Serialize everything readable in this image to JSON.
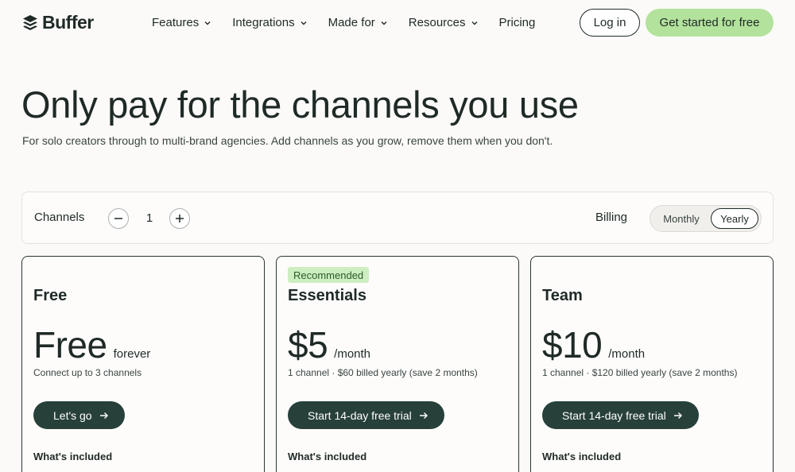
{
  "nav": {
    "brand": "Buffer",
    "menu": [
      {
        "label": "Features",
        "has_dropdown": true
      },
      {
        "label": "Integrations",
        "has_dropdown": true
      },
      {
        "label": "Made for",
        "has_dropdown": true
      },
      {
        "label": "Resources",
        "has_dropdown": true
      },
      {
        "label": "Pricing",
        "has_dropdown": false
      }
    ],
    "login_label": "Log in",
    "cta_label": "Get started for free"
  },
  "hero": {
    "title": "Only pay for the channels you use",
    "subtitle": "For solo creators through to multi-brand agencies. Add channels as you grow, remove them when you don't."
  },
  "controls": {
    "channels_label": "Channels",
    "channel_count": "1",
    "billing_label": "Billing",
    "billing_options": [
      "Monthly",
      "Yearly"
    ],
    "billing_selected": "Yearly"
  },
  "plans": [
    {
      "name": "Free",
      "badge": "",
      "price": "Free",
      "period": "forever",
      "note": "Connect up to 3 channels",
      "cta": "Let's go",
      "included_label": "What's included"
    },
    {
      "name": "Essentials",
      "badge": "Recommended",
      "price": "$5",
      "period": "/month",
      "note": "1 channel · $60 billed yearly (save 2 months)",
      "cta": "Start 14-day free trial",
      "included_label": "What's included"
    },
    {
      "name": "Team",
      "badge": "",
      "price": "$10",
      "period": "/month",
      "note": "1 channel · $120 billed yearly (save 2 months)",
      "cta": "Start 14-day free trial",
      "included_label": "What's included"
    }
  ],
  "colors": {
    "background": "#fbfaf8",
    "accent_green": "#b3e29c",
    "dark_button": "#27403a",
    "badge_bg": "#cdeec0",
    "text": "#1f2a27"
  },
  "icons": {
    "logo": "buffer-stack-icon",
    "dropdown": "chevron-down-icon",
    "minus": "minus-icon",
    "plus": "plus-icon",
    "arrow": "arrow-right-icon"
  }
}
